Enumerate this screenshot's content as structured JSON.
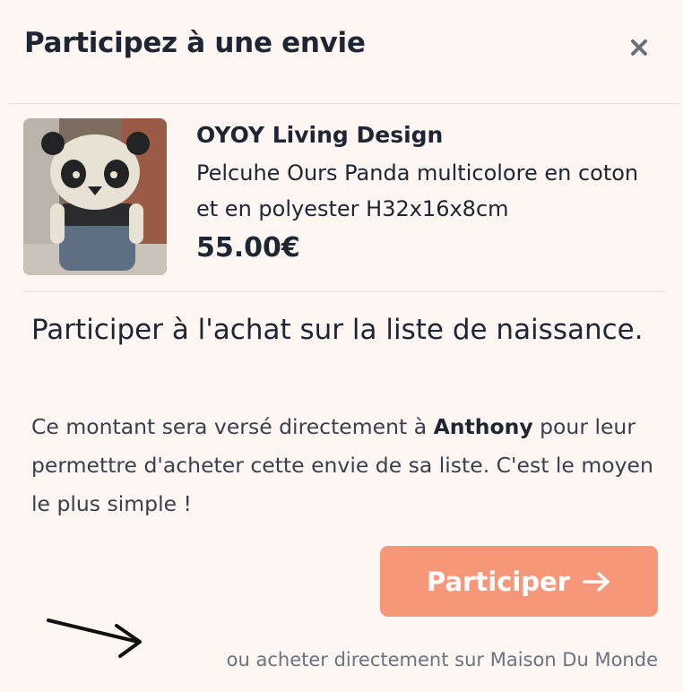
{
  "modal": {
    "title": "Participez à une envie",
    "close_icon": "close-icon"
  },
  "product": {
    "image_alt": "panda plush",
    "brand": "OYOY Living Design",
    "description": "Pelcuhe Ours Panda multicolore en coton et en polyester H32x16x8cm",
    "price": "55.00€"
  },
  "participation": {
    "title": "Participer à l'achat sur la liste de naissance.",
    "body_prefix": "Ce montant sera versé directement à ",
    "recipient": "Anthony",
    "body_suffix": " pour leur permettre d'acheter cette envie de sa liste. C'est le moyen le plus simple !",
    "button_label": "Participer",
    "button_icon": "arrow-right-icon",
    "direct_link": "ou acheter directement sur Maison Du Monde"
  },
  "colors": {
    "background": "#fdf6f3",
    "accent": "#f7977a",
    "text": "#1e2533",
    "muted": "#6b7280"
  }
}
